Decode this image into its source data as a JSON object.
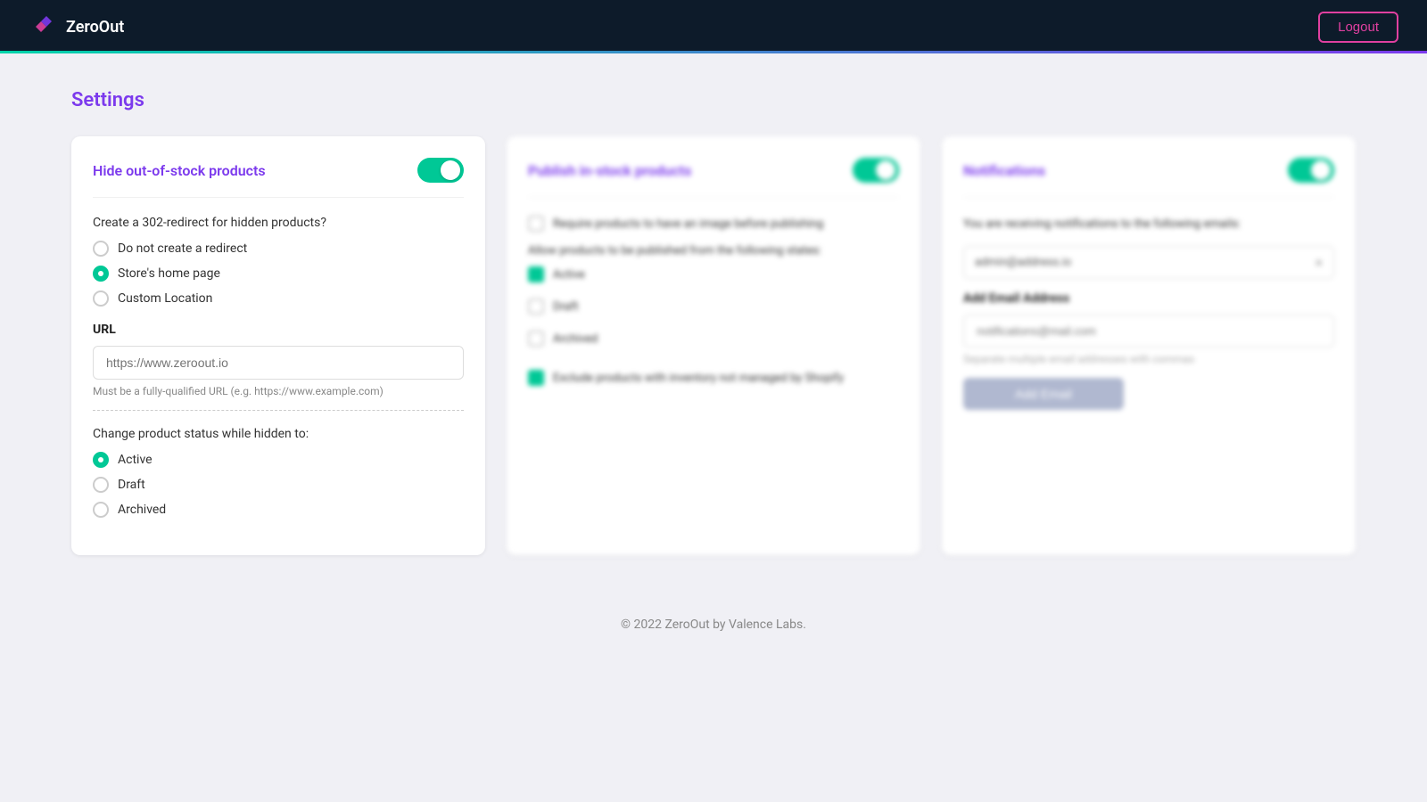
{
  "header": {
    "logo_text": "ZeroOut",
    "logout_label": "Logout"
  },
  "page": {
    "title": "Settings",
    "footer": "© 2022 ZeroOut by Valence Labs."
  },
  "card1": {
    "title": "Hide out-of-stock products",
    "toggle_on": true,
    "redirect_section_label": "Create a 302-redirect for hidden products?",
    "redirect_options": [
      {
        "label": "Do not create a redirect",
        "checked": false
      },
      {
        "label": "Store's home page",
        "checked": true
      },
      {
        "label": "Custom Location",
        "checked": false
      }
    ],
    "url_label": "URL",
    "url_placeholder": "https://www.zeroout.io",
    "url_hint": "Must be a fully-qualified URL (e.g. https://www.example.com)",
    "status_section_label": "Change product status while hidden to:",
    "status_options": [
      {
        "label": "Active",
        "checked": true
      },
      {
        "label": "Draft",
        "checked": false
      },
      {
        "label": "Archived",
        "checked": false
      }
    ]
  },
  "card2": {
    "title": "Publish in-stock products",
    "toggle_on": true,
    "require_image_label": "Require products to have an image before publishing",
    "require_image_checked": false,
    "states_label": "Allow products to be published from the following states:",
    "states": [
      {
        "label": "Active",
        "checked": true
      },
      {
        "label": "Draft",
        "checked": false
      },
      {
        "label": "Archived",
        "checked": false
      }
    ],
    "exclude_label": "Exclude products with inventory not managed by Shopify",
    "exclude_checked": true
  },
  "card3": {
    "title": "Notifications",
    "toggle_on": true,
    "receiving_text": "You are receiving notifications to the following emails:",
    "existing_email": "admin@address.io",
    "add_email_label": "Add Email Address",
    "add_email_placeholder": "notifications@mail.com",
    "add_email_hint": "Separate multiple email addresses with commas",
    "add_email_btn_label": "Add Email"
  }
}
